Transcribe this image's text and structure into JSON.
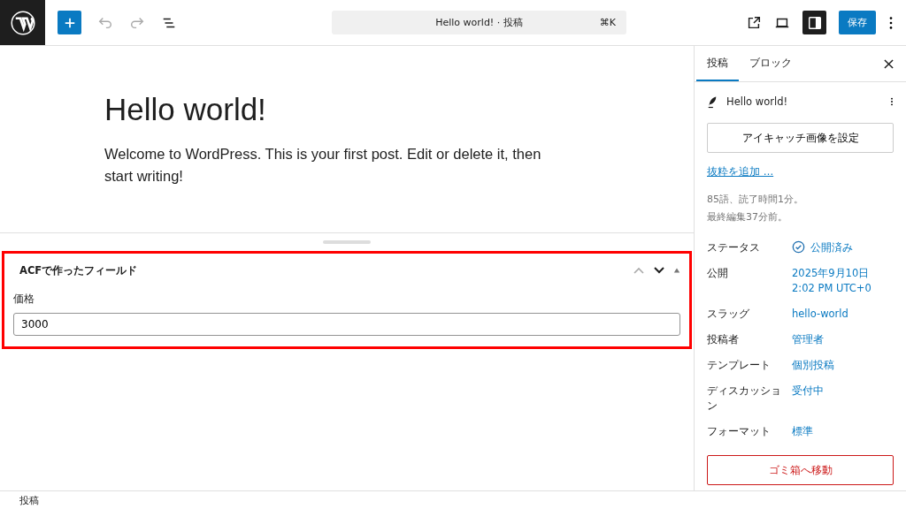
{
  "topbar": {
    "command": {
      "title": "Hello world! · 投稿",
      "shortcut": "⌘K"
    },
    "settings_open": true,
    "save": "保存"
  },
  "post": {
    "title": "Hello world!",
    "body": "Welcome to WordPress. This is your first post. Edit or delete it, then start writing!"
  },
  "metabox": {
    "title": "ACFで作ったフィールド",
    "highlighted": true,
    "fields": [
      {
        "label": "価格",
        "value": "3000"
      }
    ]
  },
  "sidebar": {
    "tabs": [
      {
        "label": "投稿",
        "selected": true
      },
      {
        "label": "ブロック",
        "selected": false
      }
    ],
    "post_title": "Hello world!",
    "featured_image_button": "アイキャッチ画像を設定",
    "excerpt_link": "抜粋を追加 …",
    "stats": [
      "85語、読了時間1分。",
      "最終編集37分前。"
    ],
    "rows": [
      {
        "label": "ステータス",
        "kind": "status",
        "lines": [
          "公開済み"
        ]
      },
      {
        "label": "公開",
        "kind": "link",
        "lines": [
          "2025年9月10日",
          "2:02 PM UTC+0"
        ]
      },
      {
        "label": "スラッグ",
        "kind": "link",
        "lines": [
          "hello-world"
        ]
      },
      {
        "label": "投稿者",
        "kind": "link",
        "lines": [
          "管理者"
        ]
      },
      {
        "label": "テンプレート",
        "kind": "link",
        "lines": [
          "個別投稿"
        ]
      },
      {
        "label": "ディスカッション",
        "kind": "link",
        "lines": [
          "受付中"
        ]
      },
      {
        "label": "フォーマット",
        "kind": "link",
        "lines": [
          "標準"
        ]
      }
    ],
    "trash_button": "ゴミ箱へ移動"
  },
  "status_bar": {
    "breadcrumb": "投稿"
  }
}
